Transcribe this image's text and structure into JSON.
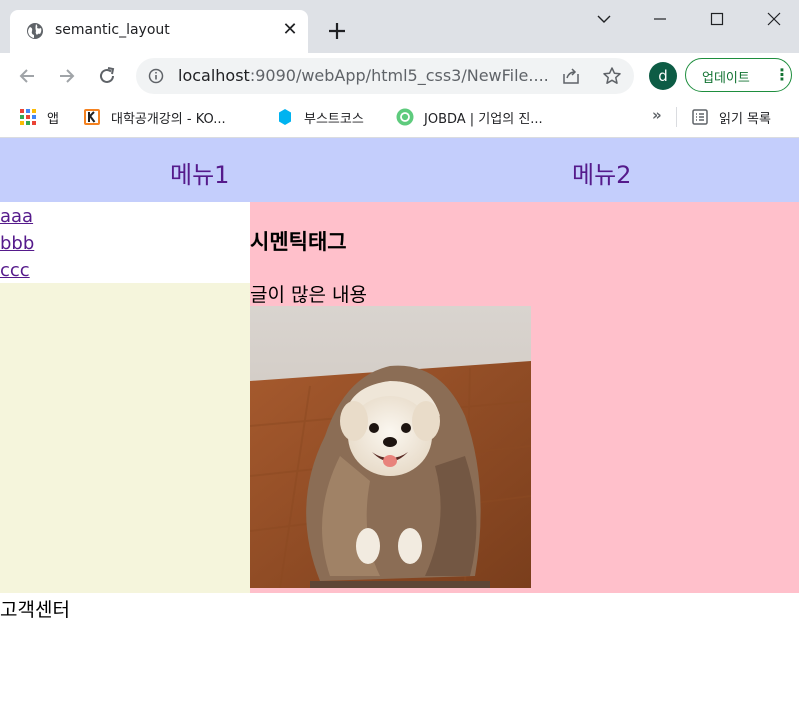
{
  "browser": {
    "tab_title": "semantic_layout",
    "url_host": "localhost",
    "url_rest": ":9090/webApp/html5_css3/NewFile....",
    "avatar_letter": "d",
    "update_label": "업데이트",
    "bookmarks": [
      {
        "label": "앱",
        "icon": "apps-grid-icon"
      },
      {
        "label": "대학공개강의 - KO...",
        "icon": "kocw-icon"
      },
      {
        "label": "부스트코스",
        "icon": "boostcourse-icon"
      },
      {
        "label": "JOBDA | 기업의 진...",
        "icon": "jobda-icon"
      }
    ],
    "more_label": "»",
    "reading_list_label": "읽기 목록"
  },
  "page": {
    "header": {
      "menu": [
        {
          "label": "메뉴1"
        },
        {
          "label": "메뉴2"
        }
      ]
    },
    "sidebar": {
      "links": [
        {
          "label": "aaa"
        },
        {
          "label": "bbb"
        },
        {
          "label": "ccc"
        }
      ]
    },
    "main": {
      "heading": "시멘틱태그",
      "text": "글이 많은 내용"
    },
    "footer": {
      "text": "고객센터"
    },
    "colors": {
      "header_bg": "#c4cefc",
      "sidebar_bg": "#f5f5dc",
      "main_bg": "#ffc0cb",
      "link": "#551a8b"
    }
  }
}
